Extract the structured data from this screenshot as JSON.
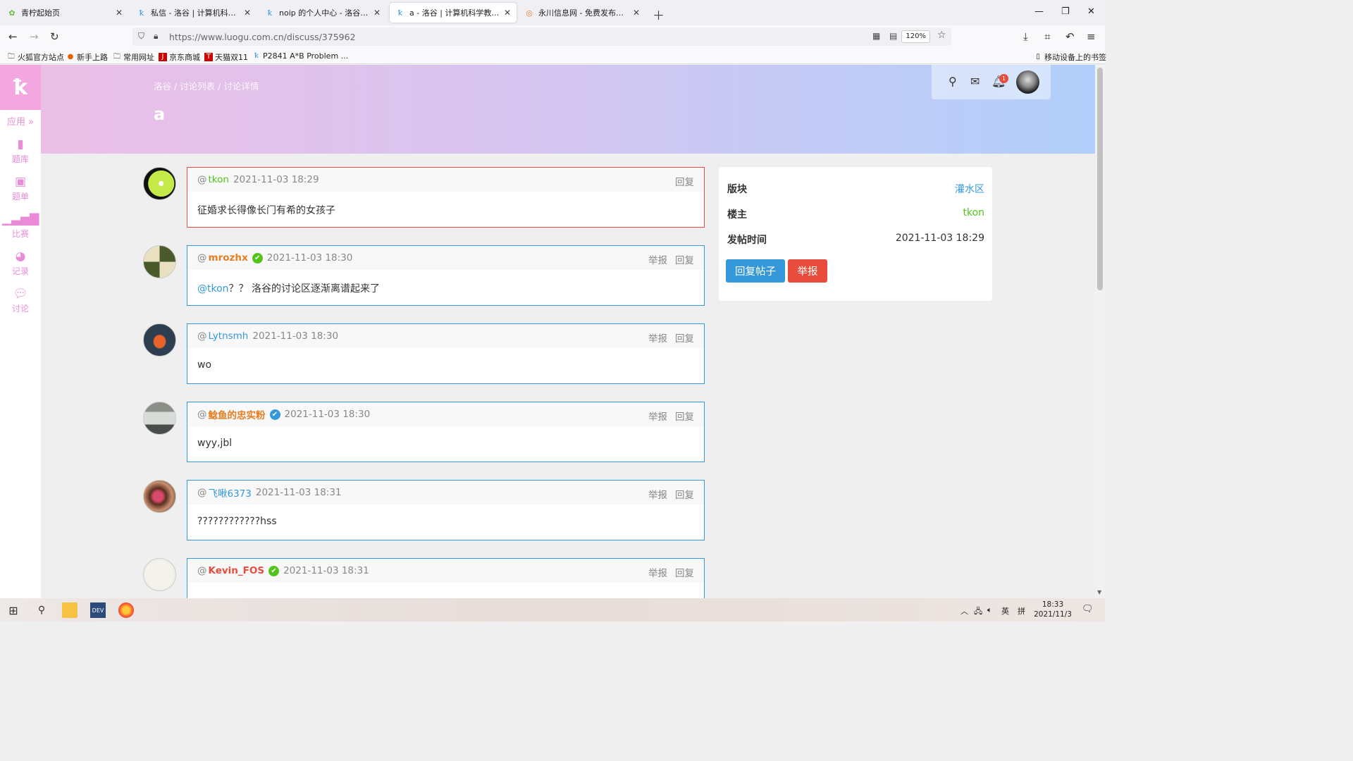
{
  "browser": {
    "tabs": [
      {
        "title": "青柠起始页",
        "favicon": "leaf-icon",
        "active": false
      },
      {
        "title": "私信 - 洛谷 | 计算机科学教育新生态",
        "favicon": "luogu-icon",
        "active": false
      },
      {
        "title": "noip 的个人中心 - 洛谷 | 计算机科学教育新生态",
        "favicon": "luogu-icon",
        "active": false
      },
      {
        "title": "a - 洛谷 | 计算机科学教育新生态",
        "favicon": "luogu-icon",
        "active": true
      },
      {
        "title": "永川信息网 - 免费发布房产、招聘",
        "favicon": "site-icon",
        "active": false
      }
    ],
    "url": "https://www.luogu.com.cn/discuss/375962",
    "zoom": "120%",
    "bookmarks": [
      "火狐官方站点",
      "新手上路",
      "常用网址",
      "京东商城",
      "天猫双11",
      "P2841 A*B Problem ..."
    ],
    "mobile_bookmarks": "移动设备上的书签"
  },
  "sidebar": {
    "apps_label": "应用 »",
    "items": [
      {
        "label": "题库",
        "icon": "book-icon"
      },
      {
        "label": "题单",
        "icon": "clipboard-icon"
      },
      {
        "label": "比赛",
        "icon": "bar-chart-icon"
      },
      {
        "label": "记录",
        "icon": "pie-chart-icon"
      },
      {
        "label": "讨论",
        "icon": "chat-icon"
      }
    ]
  },
  "header": {
    "breadcrumb": "洛谷 / 讨论列表 / 讨论详情",
    "title": "a",
    "notification_count": "1"
  },
  "replies": [
    {
      "user": "tkon",
      "time": "2021-11-03 18:29",
      "content": "征婚求长得像长门有希的女孩子",
      "name_style": "green",
      "badge": "",
      "is_op": true,
      "report": "",
      "reply": "回复"
    },
    {
      "user": "mrozhx",
      "time": "2021-11-03 18:30",
      "content_mention": "@tkon",
      "content": "？？ 洛谷的讨论区逐渐离谱起来了",
      "name_style": "orange",
      "badge": "green",
      "is_op": false,
      "report": "举报",
      "reply": "回复"
    },
    {
      "user": "Lytnsmh",
      "time": "2021-11-03 18:30",
      "content": "wo",
      "name_style": "blue",
      "badge": "",
      "is_op": false,
      "report": "举报",
      "reply": "回复"
    },
    {
      "user": "鲶鱼的忠实粉",
      "time": "2021-11-03 18:30",
      "content": "wyy,jbl",
      "name_style": "orange",
      "badge": "blue",
      "is_op": false,
      "report": "举报",
      "reply": "回复"
    },
    {
      "user": "飞啾6373",
      "time": "2021-11-03 18:31",
      "content": "????????????hss",
      "name_style": "blue",
      "badge": "",
      "is_op": false,
      "report": "举报",
      "reply": "回复"
    },
    {
      "user": "Kevin_FOS",
      "time": "2021-11-03 18:31",
      "content": "",
      "name_style": "red",
      "badge": "green",
      "is_op": false,
      "report": "举报",
      "reply": "回复"
    }
  ],
  "info_panel": {
    "forum_label": "版块",
    "forum_value": "灌水区",
    "owner_label": "楼主",
    "owner_value": "tkon",
    "time_label": "发帖时间",
    "time_value": "2021-11-03 18:29",
    "reply_button": "回复帖子",
    "report_button": "举报"
  },
  "taskbar": {
    "clock_time": "18:33",
    "clock_date": "2021/11/3",
    "ime": "英",
    "ime_mode": "拼"
  },
  "colors": {
    "accent_blue": "#3498db",
    "accent_red": "#e74c3c",
    "green": "#52c41a",
    "orange": "#e67e22",
    "sidebar_pink": "#e98bd6"
  }
}
